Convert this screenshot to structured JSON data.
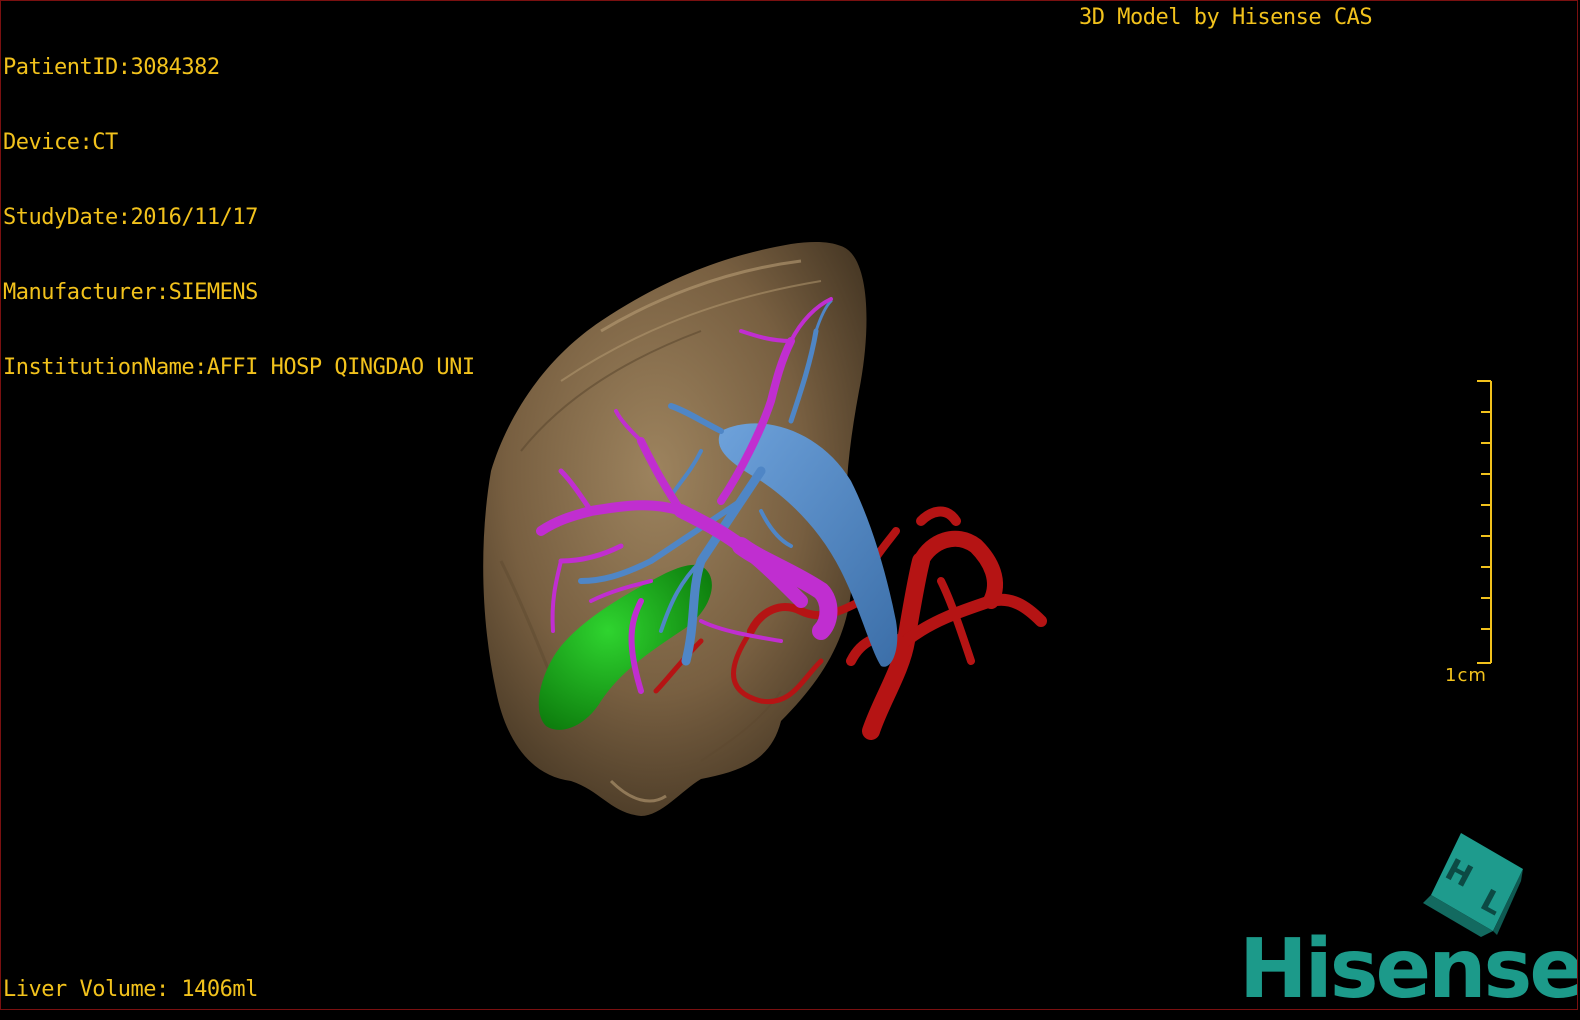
{
  "overlay": {
    "patient_id": "PatientID:3084382",
    "device": "Device:CT",
    "study_date": "StudyDate:2016/11/17",
    "manufacturer": "Manufacturer:SIEMENS",
    "institution": "InstitutionName:AFFI HOSP QINGDAO UNI",
    "model_credit": "3D Model by Hisense CAS",
    "liver_volume": "Liver Volume: 1406ml"
  },
  "scale_bar": {
    "label": "1cm"
  },
  "brand": {
    "name": "Hisense",
    "cube_letters": "H L",
    "color": "#1c9a8a"
  },
  "colors": {
    "overlay_text": "#f2c21c",
    "liver": "#8a6e4b",
    "portal_vein": "#c02ed0",
    "hepatic_vein": "#4f86c6",
    "gallbladder": "#1aa31a",
    "artery": "#b51414",
    "border": "#7a1010"
  }
}
